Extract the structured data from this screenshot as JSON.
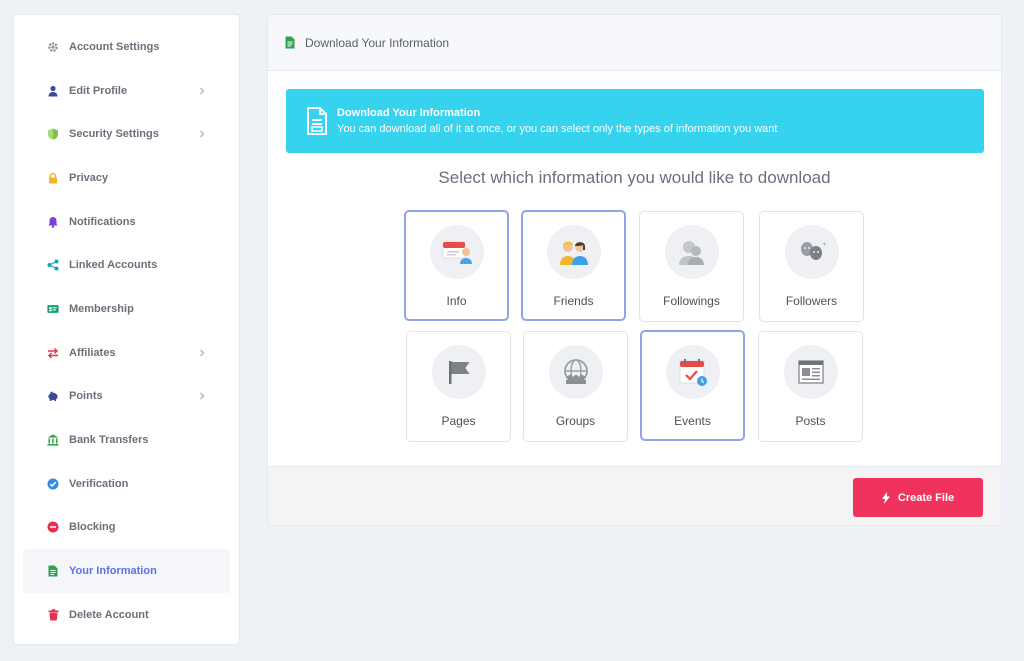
{
  "sidebar": {
    "items": [
      {
        "label": "Account Settings",
        "icon": "gear-icon",
        "color": "#8a8d97",
        "chevron": false,
        "active": false
      },
      {
        "label": "Edit Profile",
        "icon": "user-icon",
        "color": "#3b4a9c",
        "chevron": true,
        "active": false
      },
      {
        "label": "Security Settings",
        "icon": "shield-icon",
        "color": "#7bc04a",
        "chevron": true,
        "active": false
      },
      {
        "label": "Privacy",
        "icon": "lock-icon",
        "color": "#f3b530",
        "chevron": false,
        "active": false
      },
      {
        "label": "Notifications",
        "icon": "bell-icon",
        "color": "#7d3fd6",
        "chevron": false,
        "active": false
      },
      {
        "label": "Linked Accounts",
        "icon": "share-icon",
        "color": "#17a2b8",
        "chevron": false,
        "active": false
      },
      {
        "label": "Membership",
        "icon": "id-card-icon",
        "color": "#12a06a",
        "chevron": false,
        "active": false
      },
      {
        "label": "Affiliates",
        "icon": "exchange-icon",
        "color": "#e8304f",
        "chevron": true,
        "active": false
      },
      {
        "label": "Points",
        "icon": "piggy-bank-icon",
        "color": "#3b4a9c",
        "chevron": true,
        "active": false
      },
      {
        "label": "Bank Transfers",
        "icon": "bank-icon",
        "color": "#2f9e44",
        "chevron": false,
        "active": false
      },
      {
        "label": "Verification",
        "icon": "check-circle-icon",
        "color": "#2f8ae8",
        "chevron": false,
        "active": false
      },
      {
        "label": "Blocking",
        "icon": "minus-circle-icon",
        "color": "#e8304f",
        "chevron": false,
        "active": false
      },
      {
        "label": "Your Information",
        "icon": "file-icon",
        "color": "#2fa34f",
        "chevron": false,
        "active": true
      },
      {
        "label": "Delete Account",
        "icon": "trash-icon",
        "color": "#e8304f",
        "chevron": false,
        "active": false
      }
    ]
  },
  "panel": {
    "title": "Download Your Information",
    "alert": {
      "title": "Download Your Information",
      "text": "You can download all of it at once, or you can select only the types of information you want"
    },
    "select_title": "Select which information you would like to download",
    "cards": [
      {
        "label": "Info",
        "icon": "hello-badge-icon",
        "selected": true
      },
      {
        "label": "Friends",
        "icon": "friends-icon",
        "selected": true
      },
      {
        "label": "Followings",
        "icon": "followings-icon",
        "selected": false
      },
      {
        "label": "Followers",
        "icon": "followers-icon",
        "selected": false
      },
      {
        "label": "Pages",
        "icon": "flag-icon",
        "selected": false
      },
      {
        "label": "Groups",
        "icon": "globe-group-icon",
        "selected": false
      },
      {
        "label": "Events",
        "icon": "calendar-icon",
        "selected": true
      },
      {
        "label": "Posts",
        "icon": "newspaper-icon",
        "selected": false
      }
    ],
    "create_button": "Create File"
  },
  "colors": {
    "accent": "#5e72e4",
    "alert_bg": "#35d3ee",
    "create_bg": "#f0335c",
    "selected_border": "#91a4e8"
  }
}
